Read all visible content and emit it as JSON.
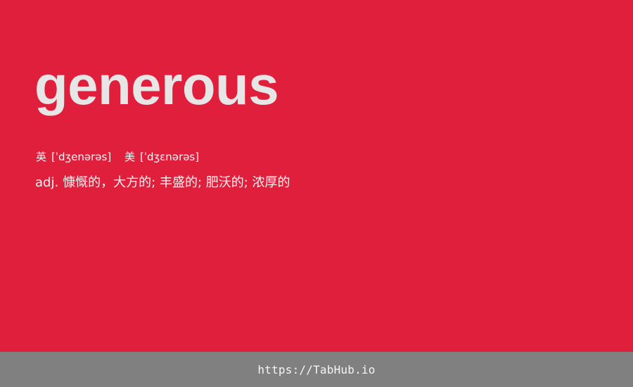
{
  "card": {
    "background_color": "#e01f3c",
    "word": "generous",
    "phonetics": {
      "uk": {
        "label": "英",
        "ipa": "[ˈdʒenərəs]"
      },
      "us": {
        "label": "美",
        "ipa": "[ˈdʒɛnərəs]"
      }
    },
    "definition": {
      "part_of_speech": "adj.",
      "meanings": "慷慨的，大方的; 丰盛的; 肥沃的; 浓厚的"
    }
  },
  "footer": {
    "background_color": "#808080",
    "link_text": "https://TabHub.io"
  }
}
